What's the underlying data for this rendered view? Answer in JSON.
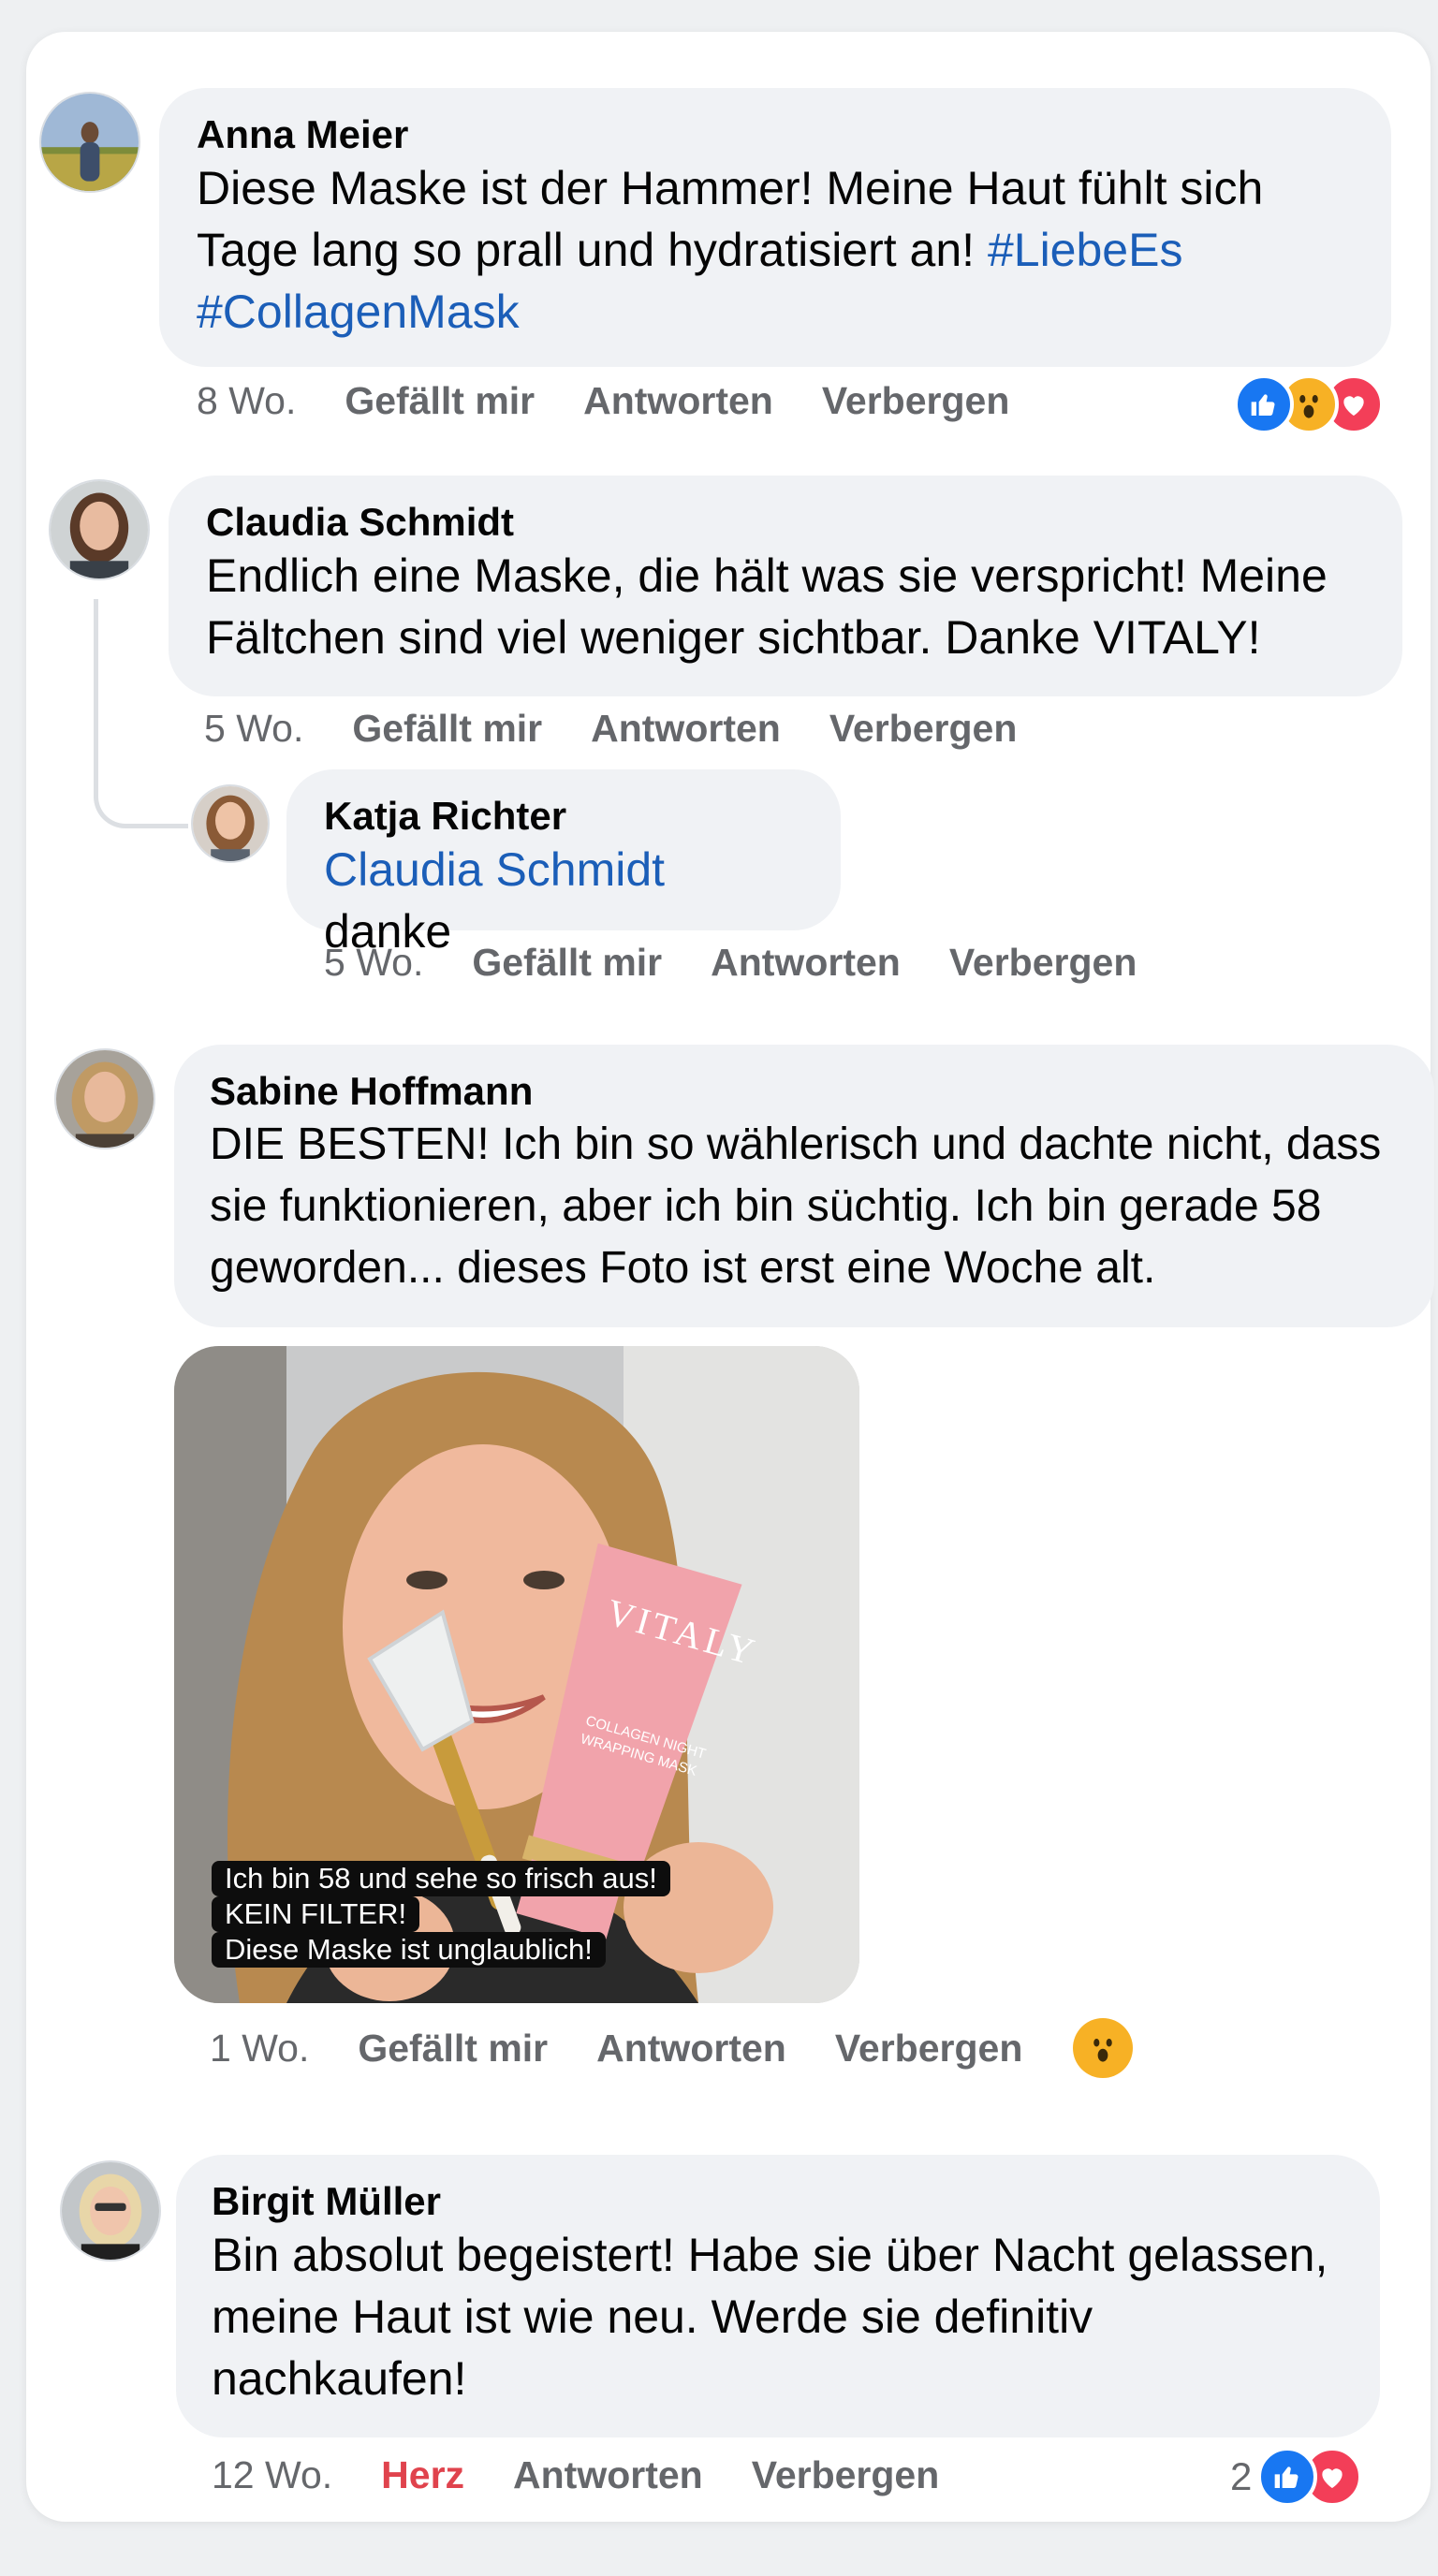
{
  "comments": [
    {
      "author": "Anna Meier",
      "text_parts": [
        "Diese Maske ist der Hammer! Meine Haut fühlt sich Tage lang so prall und hydratisiert an! ",
        "#LiebeEs",
        " ",
        "#CollagenMask"
      ],
      "time": "8 Wo.",
      "like_label": "Gefällt mir",
      "reply_label": "Antworten",
      "hide_label": "Verbergen",
      "reactions": [
        "like-icon",
        "wow-icon",
        "love-icon"
      ]
    },
    {
      "author": "Claudia Schmidt",
      "text": "Endlich eine Maske, die hält was sie verspricht! Meine Fältchen sind viel weniger sichtbar. Danke VITALY!",
      "time": "5 Wo.",
      "like_label": "Gefällt mir",
      "reply_label": "Antworten",
      "hide_label": "Verbergen",
      "reply": {
        "author": "Katja Richter",
        "mention": "Claudia Schmidt",
        "text": " danke",
        "time": "5 Wo.",
        "like_label": "Gefällt mir",
        "reply_label": "Antworten",
        "hide_label": "Verbergen"
      }
    },
    {
      "author": "Sabine Hoffmann",
      "text": "DIE BESTEN! Ich bin so wählerisch und dachte nicht, dass sie funktionieren, aber ich bin süchtig. Ich bin gerade 58 geworden... dieses Foto ist erst eine Woche alt.",
      "photo": {
        "caption_lines": [
          "Ich bin 58 und sehe so frisch aus!",
          "KEIN FILTER!",
          "Diese Maske ist unglaublich!"
        ],
        "product_brand": "VITALY",
        "product_name": "COLLAGEN NIGHT WRAPPING MASK"
      },
      "time": "1 Wo.",
      "like_label": "Gefällt mir",
      "reply_label": "Antworten",
      "hide_label": "Verbergen",
      "reactions": [
        "wow-icon"
      ]
    },
    {
      "author": "Birgit Müller",
      "text": "Bin absolut begeistert! Habe sie über Nacht gelassen, meine Haut ist wie neu. Werde sie definitiv nachkaufen!",
      "time": "12 Wo.",
      "like_label": "Herz",
      "reply_label": "Antworten",
      "hide_label": "Verbergen",
      "reaction_count": "2",
      "reactions": [
        "like-icon",
        "love-icon"
      ]
    }
  ],
  "colors": {
    "bubble": "#f0f2f5",
    "link": "#1b5eb8",
    "meta": "#65676b",
    "love_active": "#e0434d",
    "like_reaction": "#1877f2",
    "love_reaction": "#f33e58",
    "wow_reaction": "#f7b125"
  }
}
